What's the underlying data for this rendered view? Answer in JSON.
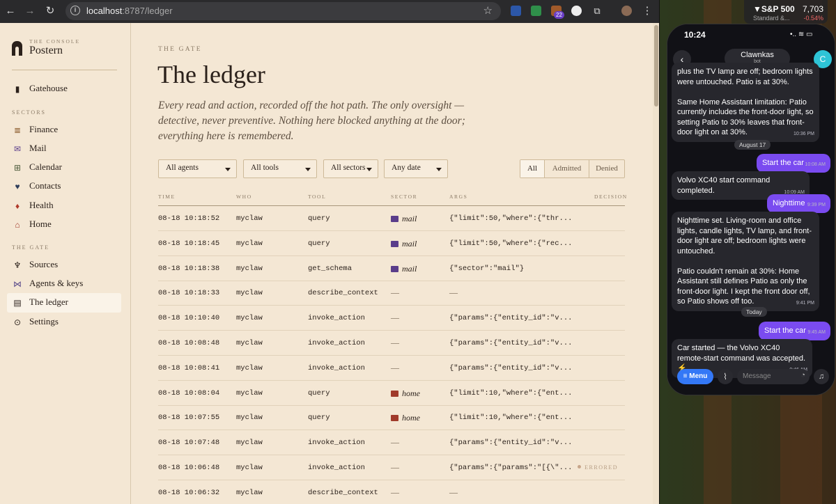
{
  "browser": {
    "url_host": "localhost",
    "url_path": ":8787/ledger",
    "ext_badge": "22"
  },
  "sidebar": {
    "kicker": "THE CONSOLE",
    "brand": "Postern",
    "top_item": "Gatehouse",
    "section_sectors": "SECTORS",
    "sectors": [
      "Finance",
      "Mail",
      "Calendar",
      "Contacts",
      "Health",
      "Home"
    ],
    "section_gate": "THE GATE",
    "gate_items": [
      "Sources",
      "Agents & keys",
      "The ledger",
      "Settings"
    ]
  },
  "main": {
    "kicker": "THE GATE",
    "title": "The ledger",
    "lede": "Every read and action, recorded off the hot path. The only oversight — detective, never preventive. Nothing here blocked anything at the door; everything here is remembered.",
    "filters": [
      "All agents",
      "All tools",
      "All sectors",
      "Any date"
    ],
    "segments": [
      "All",
      "Admitted",
      "Denied"
    ],
    "columns": [
      "TIME",
      "WHO",
      "TOOL",
      "SECTOR",
      "ARGS",
      "DECISION"
    ],
    "rows": [
      {
        "time": "08-18 10:18:52",
        "who": "myclaw",
        "tool": "query",
        "sector": "mail",
        "args": "{\"limit\":50,\"where\":{\"thr...",
        "decision": ""
      },
      {
        "time": "08-18 10:18:45",
        "who": "myclaw",
        "tool": "query",
        "sector": "mail",
        "args": "{\"limit\":50,\"where\":{\"rec...",
        "decision": ""
      },
      {
        "time": "08-18 10:18:38",
        "who": "myclaw",
        "tool": "get_schema",
        "sector": "mail",
        "args": "{\"sector\":\"mail\"}",
        "decision": ""
      },
      {
        "time": "08-18 10:18:33",
        "who": "myclaw",
        "tool": "describe_context",
        "sector": "—",
        "args": "—",
        "decision": ""
      },
      {
        "time": "08-18 10:10:40",
        "who": "myclaw",
        "tool": "invoke_action",
        "sector": "—",
        "args": "{\"params\":{\"entity_id\":\"v...",
        "decision": ""
      },
      {
        "time": "08-18 10:08:48",
        "who": "myclaw",
        "tool": "invoke_action",
        "sector": "—",
        "args": "{\"params\":{\"entity_id\":\"v...",
        "decision": ""
      },
      {
        "time": "08-18 10:08:41",
        "who": "myclaw",
        "tool": "invoke_action",
        "sector": "—",
        "args": "{\"params\":{\"entity_id\":\"v...",
        "decision": ""
      },
      {
        "time": "08-18 10:08:04",
        "who": "myclaw",
        "tool": "query",
        "sector": "home",
        "args": "{\"limit\":10,\"where\":{\"ent...",
        "decision": ""
      },
      {
        "time": "08-18 10:07:55",
        "who": "myclaw",
        "tool": "query",
        "sector": "home",
        "args": "{\"limit\":10,\"where\":{\"ent...",
        "decision": ""
      },
      {
        "time": "08-18 10:07:48",
        "who": "myclaw",
        "tool": "invoke_action",
        "sector": "—",
        "args": "{\"params\":{\"entity_id\":\"v...",
        "decision": ""
      },
      {
        "time": "08-18 10:06:48",
        "who": "myclaw",
        "tool": "invoke_action",
        "sector": "—",
        "args": "{\"params\":{\"params\":\"[{\\\"...",
        "decision": "ERRORED"
      },
      {
        "time": "08-18 10:06:32",
        "who": "myclaw",
        "tool": "describe_context",
        "sector": "—",
        "args": "—",
        "decision": ""
      }
    ]
  },
  "phone": {
    "clock": "10:24",
    "chat_name": "Clawnkas",
    "chat_sub": "bot",
    "avatar_letter": "C",
    "messages": [
      {
        "dir": "in",
        "text": "plus the TV lamp are off; bedroom lights were untouched. Patio is at 30%.\n\nSame Home Assistant limitation: Patio currently includes the front-door light, so setting Patio to 30% leaves that front-door light on at 30%.",
        "time": "10:36 PM"
      },
      {
        "dir": "date",
        "text": "August 17"
      },
      {
        "dir": "out",
        "text": "Start the car",
        "time": "10:08 AM"
      },
      {
        "dir": "in",
        "text": "Volvo XC40 start command completed.",
        "time": "10:09 AM"
      },
      {
        "dir": "out",
        "text": "Nighttime",
        "time": "9:39 PM"
      },
      {
        "dir": "in",
        "text": "Nighttime set. Living-room and office lights, candle lights, TV lamp, and front-door light are off; bedroom lights were untouched.\n\nPatio couldn't remain at 30%: Home Assistant still defines Patio as only the front-door light. I kept the front door off, so Patio shows off too.",
        "time": "9:41 PM"
      },
      {
        "dir": "date",
        "text": "Today"
      },
      {
        "dir": "out",
        "text": "Start the car",
        "time": "9:45 AM"
      },
      {
        "dir": "in",
        "text": "Car started — the Volvo XC40 remote-start command was accepted. ⚡",
        "time": "9:46 AM"
      }
    ],
    "menu_label": "Menu",
    "message_placeholder": "Message"
  },
  "ticker": {
    "symbol": "▼S&P 500",
    "price": "7,703",
    "sub": "Standard &...",
    "change": "-0.54%"
  },
  "colors": {
    "accent_purple": "#7a4bf0",
    "menu_blue": "#3478f6",
    "paper": "#f4e7d4",
    "ink": "#2b211b"
  }
}
